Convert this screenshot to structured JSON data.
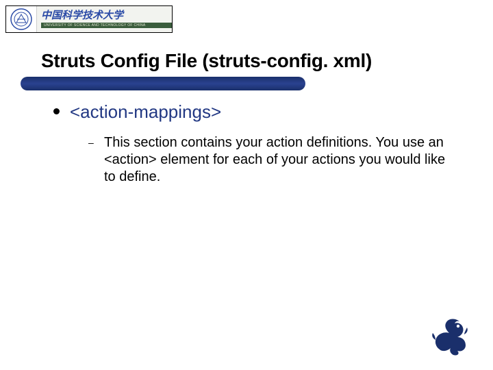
{
  "logo": {
    "chinese": "中国科学技术大学",
    "english": "UNIVERSITY OF SCIENCE AND TECHNOLOGY OF CHINA"
  },
  "title": "Struts Config File (struts-config. xml)",
  "bullet1": "<action-mappings>",
  "body1": "This section contains your action definitions. You use an <action> element for each of your actions you would like to define."
}
